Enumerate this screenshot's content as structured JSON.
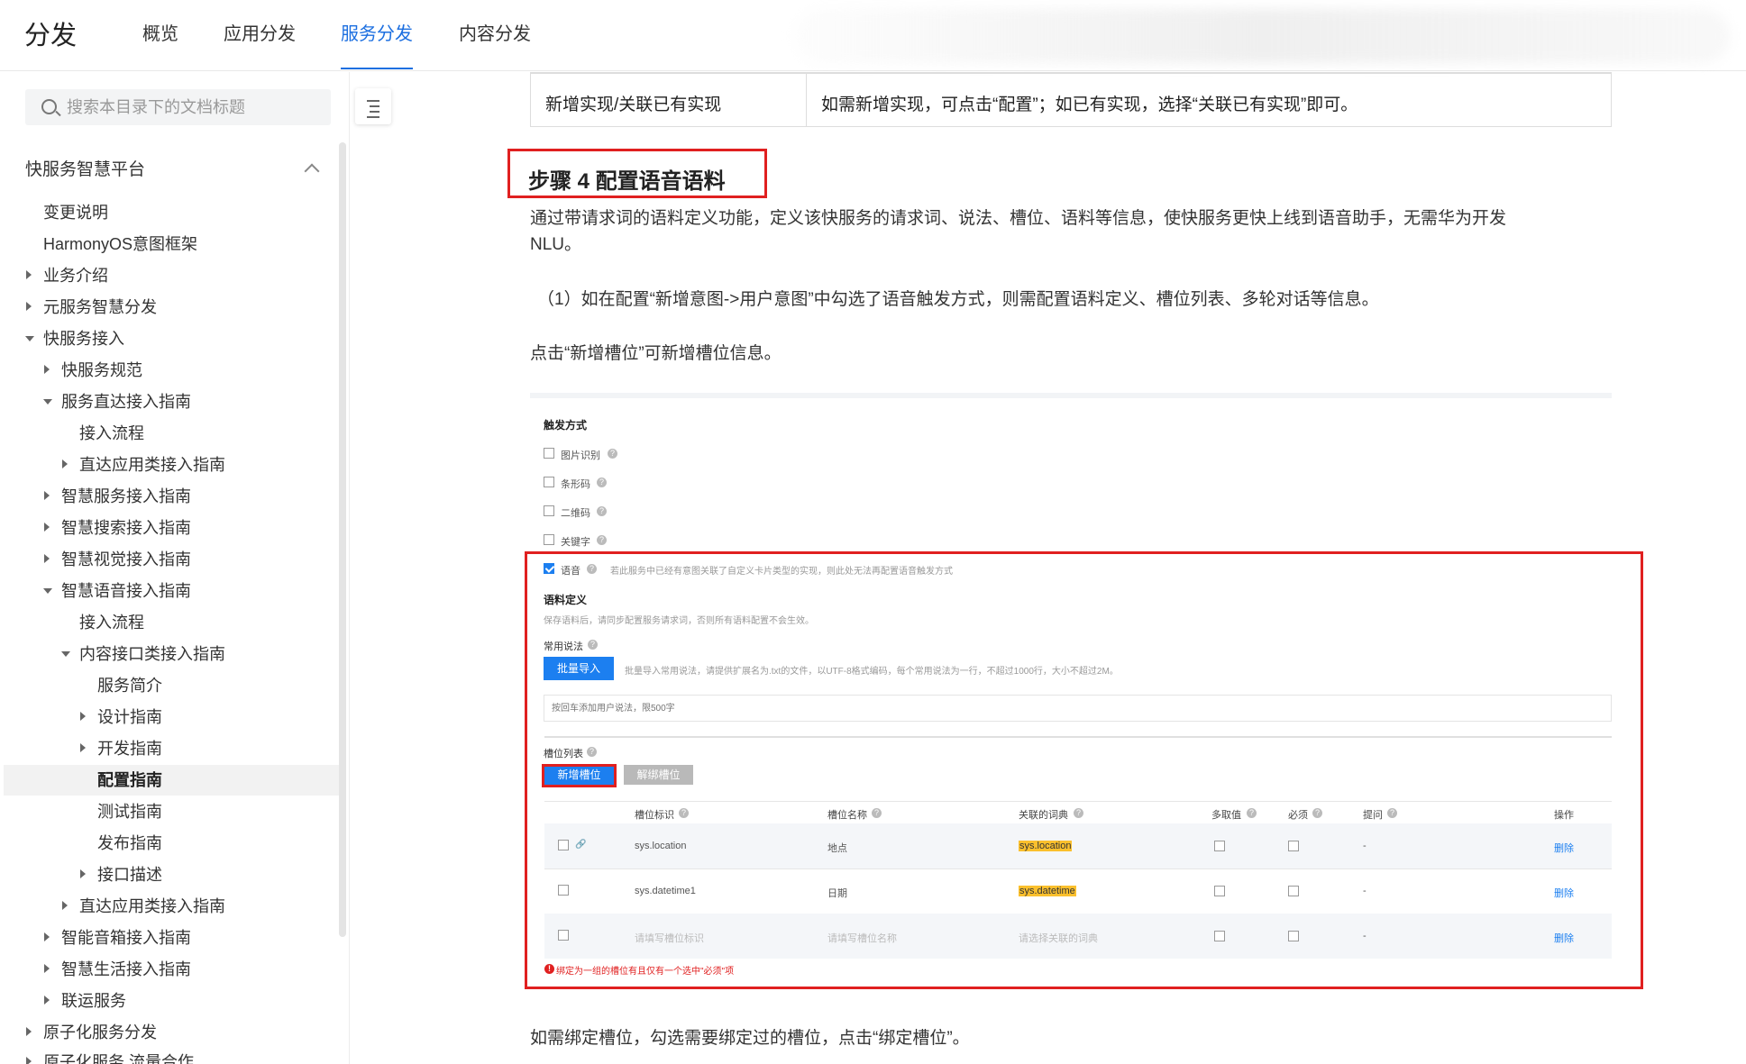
{
  "header": {
    "brand": "分发",
    "tabs": [
      {
        "label": "概览"
      },
      {
        "label": "应用分发"
      },
      {
        "label": "服务分发"
      },
      {
        "label": "内容分发"
      }
    ]
  },
  "sidebar": {
    "search_placeholder": "搜索本目录下的文档标题",
    "section_title": "快服务智慧平台",
    "items": [
      {
        "label": "变更说明"
      },
      {
        "label": "HarmonyOS意图框架"
      },
      {
        "label": "业务介绍"
      },
      {
        "label": "元服务智慧分发"
      },
      {
        "label": "快服务接入"
      },
      {
        "label": "快服务规范"
      },
      {
        "label": "服务直达接入指南"
      },
      {
        "label": "接入流程"
      },
      {
        "label": "直达应用类接入指南"
      },
      {
        "label": "智慧服务接入指南"
      },
      {
        "label": "智慧搜索接入指南"
      },
      {
        "label": "智慧视觉接入指南"
      },
      {
        "label": "智慧语音接入指南"
      },
      {
        "label": "接入流程"
      },
      {
        "label": "内容接口类接入指南"
      },
      {
        "label": "服务简介"
      },
      {
        "label": "设计指南"
      },
      {
        "label": "开发指南"
      },
      {
        "label": "配置指南"
      },
      {
        "label": "测试指南"
      },
      {
        "label": "发布指南"
      },
      {
        "label": "接口描述"
      },
      {
        "label": "直达应用类接入指南"
      },
      {
        "label": "智能音箱接入指南"
      },
      {
        "label": "智慧生活接入指南"
      },
      {
        "label": "联运服务"
      },
      {
        "label": "原子化服务分发"
      },
      {
        "label": "原子化服务 流量合作"
      }
    ]
  },
  "content": {
    "table_row": {
      "col1": "新增实现/关联已有实现",
      "col2": "如需新增实现，可点击“配置”；如已有实现，选择“关联已有实现”即可。"
    },
    "step_title": "步骤 4 配置语音语料",
    "para1_line1": "通过带请求词的语料定义功能，定义该快服务的请求词、说法、槽位、语料等信息，使快服务更快上线到语音助手，无需华为开发",
    "para1_line2": "NLU。",
    "para2": "（1）如在配置“新增意图->用户意图”中勾选了语音触发方式，则需配置语料定义、槽位列表、多轮对话等信息。",
    "para3": "点击“新增槽位”可新增槽位信息。",
    "para4": "如需绑定槽位，勾选需要绑定过的槽位，点击“绑定槽位”。"
  },
  "screenshot": {
    "trigger_title": "触发方式",
    "triggers": [
      "图片识别",
      "条形码",
      "二维码",
      "关键字"
    ],
    "voice_label": "语音",
    "voice_note": "若此服务中已经有意图关联了自定义卡片类型的实现，则此处无法再配置语音触发方式",
    "corpus_title": "语料定义",
    "corpus_note": "保存语料后，请同步配置服务请求词，否则所有语料配置不会生效。",
    "common_say_label": "常用说法",
    "bulk_import_label": "批量导入",
    "bulk_import_note": "批量导入常用说法，请提供扩展名为.txt的文件，以UTF-8格式编码，每个常用说法为一行，不超过1000行，大小不超过2M。",
    "say_input_placeholder": "按回车添加用户说法，限500字",
    "slot_list_label": "槽位列表",
    "add_slot_label": "新增槽位",
    "unbind_slot_label": "解绑槽位",
    "columns": [
      "槽位标识",
      "槽位名称",
      "关联的词典",
      "多取值",
      "必须",
      "提问",
      "操作"
    ],
    "rows": [
      {
        "id": "sys.location",
        "name": "地点",
        "dict": "sys.location",
        "ask": "-",
        "action": "删除"
      },
      {
        "id": "sys.datetime1",
        "name": "日期",
        "dict": "sys.datetime",
        "ask": "-",
        "action": "删除"
      },
      {
        "id": "请填写槽位标识",
        "name": "请填写槽位名称",
        "dict": "请选择关联的词典",
        "ask": "-",
        "action": "删除"
      }
    ],
    "error_note": "绑定为一组的槽位有且仅有一个选中\"必须\"项"
  }
}
